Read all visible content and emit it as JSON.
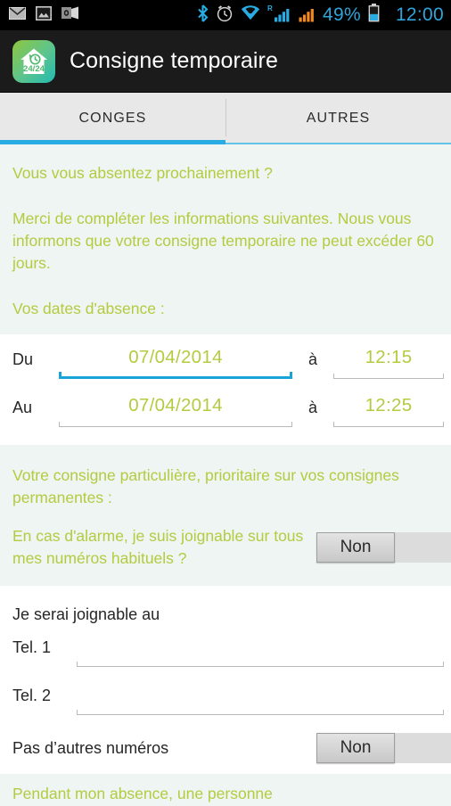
{
  "status_bar": {
    "left_icons": [
      "mail-icon",
      "gallery-icon",
      "outlook-icon"
    ],
    "right_icons": [
      "bluetooth-icon",
      "alarm-icon",
      "wifi-icon",
      "signal-roaming-icon",
      "signal-icon"
    ],
    "roaming_label": "R",
    "battery_percent": "49%",
    "clock": "12:00",
    "accent_color": "#2fa5dc"
  },
  "action_bar": {
    "app_icon_name": "home-24-24-icon",
    "app_icon_text": "24/24",
    "title": "Consigne temporaire"
  },
  "tabs": [
    {
      "label": "CONGES",
      "active": true
    },
    {
      "label": "AUTRES",
      "active": false
    }
  ],
  "content": {
    "intro_question": "Vous vous absentez prochainement ?",
    "instructions": "Merci de compléter les informations suivantes. Nous vous informons que votre consigne temporaire ne peut excéder 60 jours.",
    "dates_heading": "Vos dates d'absence :",
    "date_rows": [
      {
        "label": "Du",
        "date_value": "07/04/2014",
        "separator": "à",
        "time_value": "12:15",
        "date_focused": true,
        "time_focused": false
      },
      {
        "label": "Au",
        "date_value": "07/04/2014",
        "separator": "à",
        "time_value": "12:25",
        "date_focused": false,
        "time_focused": false
      }
    ],
    "consigne_heading": "Votre consigne particulière, prioritaire sur vos consignes permanentes :",
    "alarm_question": "En cas d'alarme, je suis joignable sur tous mes numéros habituels ?",
    "alarm_toggle_value": "Non",
    "reachable_heading": "Je serai joignable au",
    "tel_rows": [
      {
        "label": "Tel. 1",
        "value": "",
        "placeholder": ""
      },
      {
        "label": "Tel. 2",
        "value": "",
        "placeholder": ""
      }
    ],
    "no_other_numbers_label": "Pas d’autres numéros",
    "no_other_numbers_toggle_value": "Non",
    "footer_text_truncated": "Pendant mon absence, une personne"
  },
  "colors": {
    "green_text": "#b4cb40",
    "accent_blue": "#29ace3",
    "mint_bg": "#eef5f2",
    "dark_text": "#262626"
  }
}
